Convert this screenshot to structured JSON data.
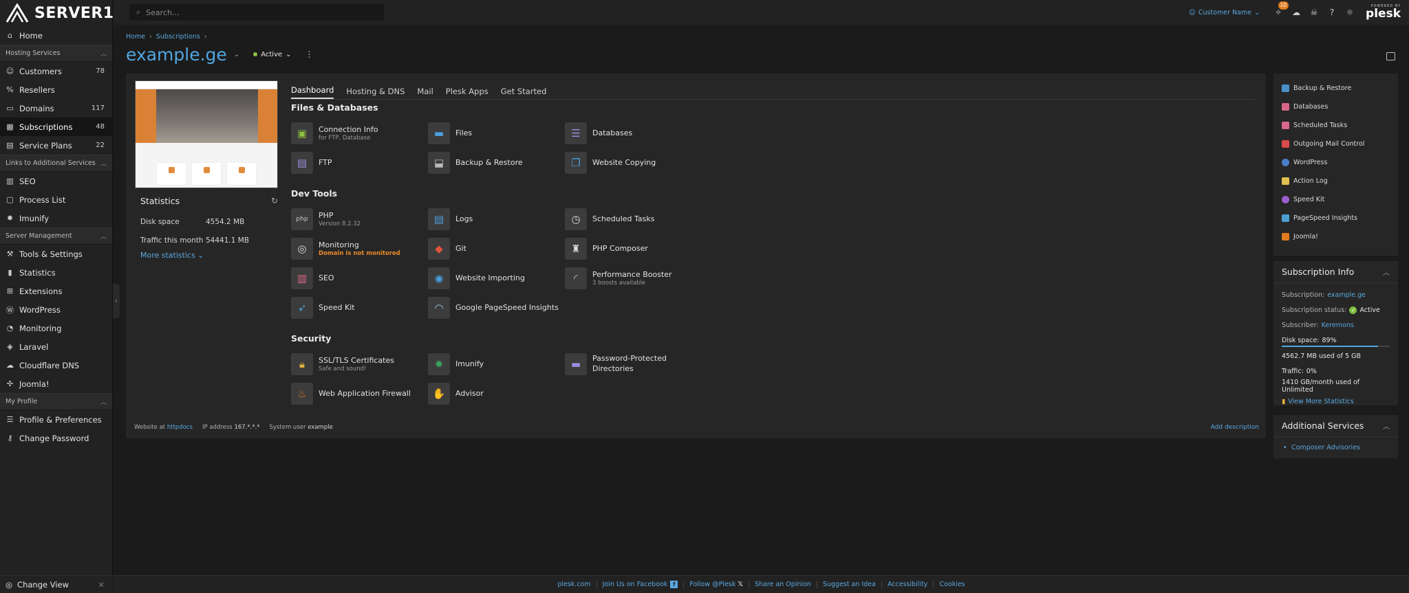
{
  "brand": {
    "name": "SERVER1"
  },
  "search": {
    "placeholder": "Search..."
  },
  "topbar": {
    "customer": "Customer Name",
    "notification_count": "10",
    "powered_by": "POWERED BY",
    "plesk": "plesk"
  },
  "sidebar": {
    "home": "Home",
    "groups": {
      "hosting": "Hosting Services",
      "links": "Links to Additional Services",
      "server": "Server Management",
      "profile": "My Profile"
    },
    "hosting": [
      {
        "label": "Customers",
        "count": "78",
        "icon": "customers-icon"
      },
      {
        "label": "Resellers",
        "count": "",
        "icon": "resellers-icon"
      },
      {
        "label": "Domains",
        "count": "117",
        "icon": "domains-icon"
      },
      {
        "label": "Subscriptions",
        "count": "48",
        "icon": "subscriptions-icon"
      },
      {
        "label": "Service Plans",
        "count": "22",
        "icon": "service-plans-icon"
      }
    ],
    "links": [
      {
        "label": "SEO"
      },
      {
        "label": "Process List"
      },
      {
        "label": "Imunify"
      }
    ],
    "server": [
      {
        "label": "Tools & Settings"
      },
      {
        "label": "Statistics"
      },
      {
        "label": "Extensions"
      },
      {
        "label": "WordPress"
      },
      {
        "label": "Monitoring"
      },
      {
        "label": "Laravel"
      },
      {
        "label": "Cloudflare DNS"
      },
      {
        "label": "Joomla!"
      }
    ],
    "profile": [
      {
        "label": "Profile & Preferences"
      },
      {
        "label": "Change Password"
      }
    ],
    "change_view": "Change View"
  },
  "breadcrumb": [
    "Home",
    "Subscriptions"
  ],
  "page": {
    "title": "example.ge",
    "status": "Active"
  },
  "stats": {
    "title": "Statistics",
    "disk_label": "Disk space",
    "disk_value": "4554.2 MB",
    "traffic_label": "Traffic this month",
    "traffic_value": "54441.1 MB",
    "more": "More statistics"
  },
  "tabs": [
    "Dashboard",
    "Hosting & DNS",
    "Mail",
    "Plesk Apps",
    "Get Started"
  ],
  "sections": {
    "files": "Files & Databases",
    "dev": "Dev Tools",
    "security": "Security"
  },
  "tools": {
    "connection": {
      "name": "Connection Info",
      "sub": "for FTP, Database"
    },
    "files": {
      "name": "Files"
    },
    "databases": {
      "name": "Databases"
    },
    "ftp": {
      "name": "FTP"
    },
    "backup": {
      "name": "Backup & Restore"
    },
    "copying": {
      "name": "Website Copying"
    },
    "php": {
      "name": "PHP",
      "sub": "Version 8.2.32"
    },
    "logs": {
      "name": "Logs"
    },
    "tasks": {
      "name": "Scheduled Tasks"
    },
    "monitoring": {
      "name": "Monitoring",
      "warn": "Domain is not monitored"
    },
    "git": {
      "name": "Git"
    },
    "composer": {
      "name": "PHP Composer"
    },
    "seo": {
      "name": "SEO"
    },
    "importing": {
      "name": "Website Importing"
    },
    "booster": {
      "name": "Performance Booster",
      "sub": "3 boosts available"
    },
    "speedkit": {
      "name": "Speed Kit"
    },
    "pagespeed": {
      "name": "Google PageSpeed Insights"
    },
    "ssl": {
      "name": "SSL/TLS Certificates",
      "sub": "Safe and sound!"
    },
    "imunify": {
      "name": "Imunify"
    },
    "pwdirs": {
      "name": "Password-Protected Directories"
    },
    "waf": {
      "name": "Web Application Firewall"
    },
    "advisor": {
      "name": "Advisor"
    }
  },
  "footer_info": {
    "website_at": "Website at",
    "docroot": "httpdocs",
    "ip_label": "IP address",
    "ip_value": "167.*.*.*",
    "user_label": "System user",
    "user_value": "example",
    "add_description": "Add description"
  },
  "quick_links": [
    {
      "label": "Backup & Restore",
      "color": "#4a90c8"
    },
    {
      "label": "Databases",
      "color": "#d9668a"
    },
    {
      "label": "Scheduled Tasks",
      "color": "#d9668a"
    },
    {
      "label": "Outgoing Mail Control",
      "color": "#d94a4a"
    },
    {
      "label": "WordPress",
      "color": "#4a7fc8"
    },
    {
      "label": "Action Log",
      "color": "#e0c050"
    },
    {
      "label": "Speed Kit",
      "color": "#9b5fd0"
    },
    {
      "label": "PageSpeed Insights",
      "color": "#4a9fd0"
    },
    {
      "label": "Joomla!",
      "color": "#e07b1e"
    }
  ],
  "subscription_info": {
    "title": "Subscription Info",
    "subscription_label": "Subscription:",
    "subscription_value": "example.ge",
    "status_label": "Subscription status:",
    "status_value": "Active",
    "subscriber_label": "Subscriber:",
    "subscriber_value": "Keremons",
    "disk_label": "Disk space:",
    "disk_pct": "89%",
    "disk_fraction": 0.89,
    "disk_used": "4562.7 MB used of 5 GB",
    "traffic_label": "Traffic:",
    "traffic_pct": "0%",
    "traffic_used": "1410 GB/month used of Unlimited",
    "view_more": "View More Statistics"
  },
  "additional_services": {
    "title": "Additional Services",
    "items": [
      "Composer Advisories"
    ]
  },
  "bottom_footer": [
    "plesk.com",
    "Join Us on Facebook",
    "Follow @Plesk",
    "Share an Opinion",
    "Suggest an Idea",
    "Accessibility",
    "Cookies"
  ]
}
